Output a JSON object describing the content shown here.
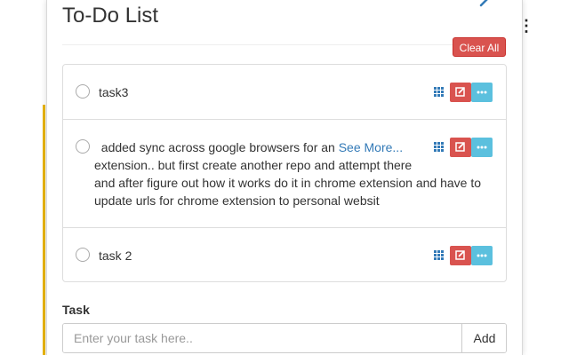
{
  "app": {
    "title": "To-Do List",
    "clear_all_label": "Clear All"
  },
  "tasks": [
    {
      "segments": [
        "task3"
      ]
    },
    {
      "segments": [
        "added sync across google browsers for an",
        "See More...",
        "extension.. but first create another repo and attempt there",
        "and after figure out how it works do it in chrome extension and have to",
        "update urls for chrome extension to personal websit"
      ]
    },
    {
      "segments": [
        "task 2"
      ]
    }
  ],
  "form": {
    "label": "Task",
    "placeholder": "Enter your task here..",
    "add_label": "Add"
  },
  "colors": {
    "danger": "#d9534f",
    "info": "#5bc0de",
    "link": "#337ab7"
  },
  "icons": {
    "item_menu": "grid-icon",
    "edit": "edit-icon",
    "more": "ellipsis-icon",
    "corner": "wrench-icon"
  }
}
